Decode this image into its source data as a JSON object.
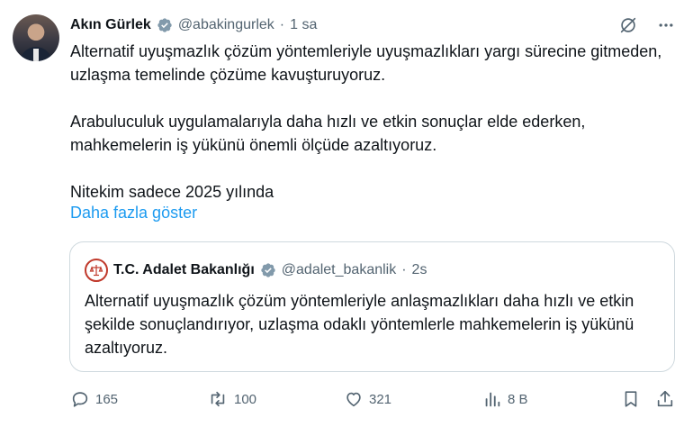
{
  "author": {
    "name": "Akın Gürlek",
    "handle": "@abakingurlek",
    "separator": "·",
    "time": "1 sa"
  },
  "tweet": {
    "paragraphs": [
      "Alternatif uyuşmazlık çözüm yöntemleriyle uyuşmazlıkları yargı sürecine gitmeden, uzlaşma temelinde çözüme kavuşturuyoruz.",
      "Arabuluculuk uygulamalarıyla daha hızlı ve etkin sonuçlar elde ederken, mahkemelerin iş yükünü önemli ölçüde azaltıyoruz.",
      "Nitekim sadece 2025 yılında"
    ],
    "show_more": "Daha fazla göster"
  },
  "quoted": {
    "name": "T.C. Adalet Bakanlığı",
    "handle": "@adalet_bakanlik",
    "separator": "·",
    "time": "2s",
    "text": "Alternatif uyuşmazlık çözüm yöntemleriyle anlaşmazlıkları daha hızlı ve etkin şekilde sonuçlandırıyor, uzlaşma odaklı yöntemlerle mahkemelerin iş yükünü azaltıyoruz."
  },
  "actions": {
    "replies": "165",
    "reposts": "100",
    "likes": "321",
    "views": "8 B"
  },
  "icons": {
    "verified": "verified-badge-icon",
    "grok": "grok-icon",
    "more": "more-icon",
    "reply": "reply-icon",
    "repost": "repost-icon",
    "like": "heart-icon",
    "views": "views-icon",
    "bookmark": "bookmark-icon",
    "share": "share-icon"
  },
  "colors": {
    "link": "#1d9bf0",
    "muted": "#536471",
    "border": "#cfd9de",
    "verified_gray": "#829aab"
  }
}
